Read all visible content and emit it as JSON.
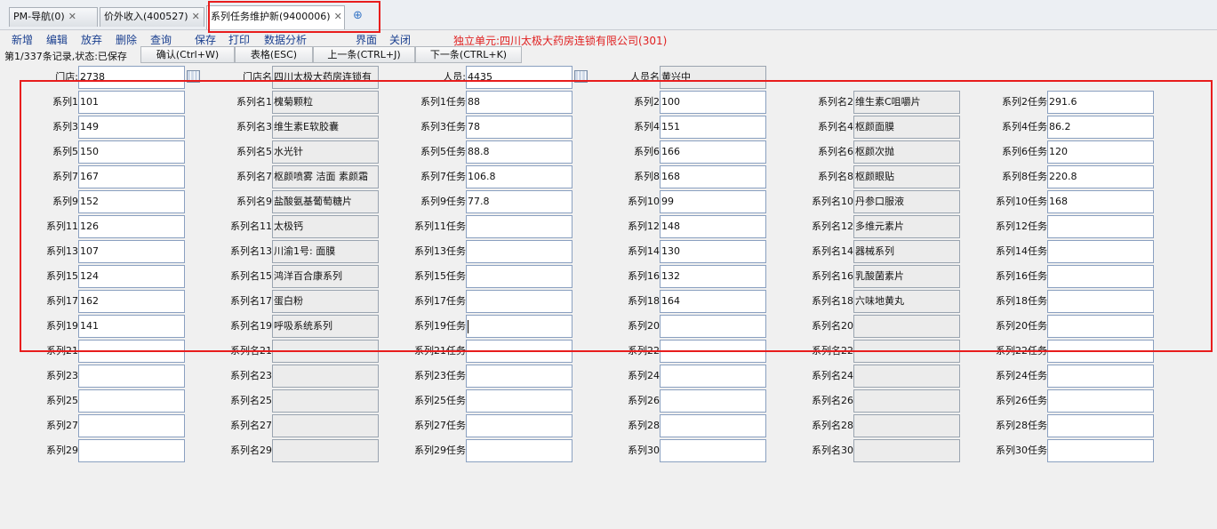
{
  "tabs": [
    {
      "label": "PM-导航(0)"
    },
    {
      "label": "价外收入(400527)"
    },
    {
      "label": "系列任务维护新(9400006)"
    }
  ],
  "toolbar": {
    "items": [
      "新增",
      "编辑",
      "放弃",
      "删除",
      "查询",
      "保存",
      "打印",
      "数据分析",
      "界面",
      "关闭"
    ]
  },
  "unit_text": "独立单元:四川太极大药房连锁有限公司(301)",
  "status": {
    "record": "第1/337条记录,状态:已保存"
  },
  "actions": [
    "确认(Ctrl+W)",
    "表格(ESC)",
    "上一条(CTRL+J)",
    "下一条(CTRL+K)"
  ],
  "header": {
    "store_label": "门店:",
    "store_value": "2738",
    "store_name_label": "门店名",
    "store_name_value": "四川太极大药房连锁有",
    "person_label": "人员:",
    "person_value": "4435",
    "person_name_label": "人员名",
    "person_name_value": "黄兴中"
  },
  "series": [
    {
      "l1": "系列1",
      "v1": "101",
      "l2": "系列名1",
      "v2": "槐菊颗粒",
      "l3": "系列1任务",
      "v3": "88"
    },
    {
      "l1": "系列2",
      "v1": "100",
      "l2": "系列名2",
      "v2": "维生素C咀嚼片",
      "l3": "系列2任务",
      "v3": "291.6"
    },
    {
      "l1": "系列3",
      "v1": "149",
      "l2": "系列名3",
      "v2": "维生素E软胶囊",
      "l3": "系列3任务",
      "v3": "78"
    },
    {
      "l1": "系列4",
      "v1": "151",
      "l2": "系列名4",
      "v2": "枢颜面膜",
      "l3": "系列4任务",
      "v3": "86.2"
    },
    {
      "l1": "系列5",
      "v1": "150",
      "l2": "系列名5",
      "v2": "水光针",
      "l3": "系列5任务",
      "v3": "88.8"
    },
    {
      "l1": "系列6",
      "v1": "166",
      "l2": "系列名6",
      "v2": "枢颜次抛",
      "l3": "系列6任务",
      "v3": "120"
    },
    {
      "l1": "系列7",
      "v1": "167",
      "l2": "系列名7",
      "v2": "枢颜喷雾 洁面 素颜霜",
      "l3": "系列7任务",
      "v3": "106.8"
    },
    {
      "l1": "系列8",
      "v1": "168",
      "l2": "系列名8",
      "v2": "枢颜眼贴",
      "l3": "系列8任务",
      "v3": "220.8"
    },
    {
      "l1": "系列9",
      "v1": "152",
      "l2": "系列名9",
      "v2": "盐酸氨基葡萄糖片",
      "l3": "系列9任务",
      "v3": "77.8"
    },
    {
      "l1": "系列10",
      "v1": "99",
      "l2": "系列名10",
      "v2": "丹参口服液",
      "l3": "系列10任务",
      "v3": "168"
    },
    {
      "l1": "系列11",
      "v1": "126",
      "l2": "系列名11",
      "v2": "太极钙",
      "l3": "系列11任务",
      "v3": ""
    },
    {
      "l1": "系列12",
      "v1": "148",
      "l2": "系列名12",
      "v2": "多维元素片",
      "l3": "系列12任务",
      "v3": ""
    },
    {
      "l1": "系列13",
      "v1": "107",
      "l2": "系列名13",
      "v2": "川渝1号: 面膜",
      "l3": "系列13任务",
      "v3": ""
    },
    {
      "l1": "系列14",
      "v1": "130",
      "l2": "系列名14",
      "v2": "器械系列",
      "l3": "系列14任务",
      "v3": ""
    },
    {
      "l1": "系列15",
      "v1": "124",
      "l2": "系列名15",
      "v2": "鸿洋百合康系列",
      "l3": "系列15任务",
      "v3": ""
    },
    {
      "l1": "系列16",
      "v1": "132",
      "l2": "系列名16",
      "v2": "乳酸菌素片",
      "l3": "系列16任务",
      "v3": ""
    },
    {
      "l1": "系列17",
      "v1": "162",
      "l2": "系列名17",
      "v2": "蛋白粉",
      "l3": "系列17任务",
      "v3": ""
    },
    {
      "l1": "系列18",
      "v1": "164",
      "l2": "系列名18",
      "v2": "六味地黄丸",
      "l3": "系列18任务",
      "v3": ""
    },
    {
      "l1": "系列19",
      "v1": "141",
      "l2": "系列名19",
      "v2": "呼吸系统系列",
      "l3": "系列19任务",
      "v3": ""
    },
    {
      "l1": "系列20",
      "v1": "",
      "l2": "系列名20",
      "v2": "",
      "l3": "系列20任务",
      "v3": ""
    },
    {
      "l1": "系列21",
      "v1": "",
      "l2": "系列名21",
      "v2": "",
      "l3": "系列21任务",
      "v3": ""
    },
    {
      "l1": "系列22",
      "v1": "",
      "l2": "系列名22",
      "v2": "",
      "l3": "系列22任务",
      "v3": ""
    },
    {
      "l1": "系列23",
      "v1": "",
      "l2": "系列名23",
      "v2": "",
      "l3": "系列23任务",
      "v3": ""
    },
    {
      "l1": "系列24",
      "v1": "",
      "l2": "系列名24",
      "v2": "",
      "l3": "系列24任务",
      "v3": ""
    },
    {
      "l1": "系列25",
      "v1": "",
      "l2": "系列名25",
      "v2": "",
      "l3": "系列25任务",
      "v3": ""
    },
    {
      "l1": "系列26",
      "v1": "",
      "l2": "系列名26",
      "v2": "",
      "l3": "系列26任务",
      "v3": ""
    },
    {
      "l1": "系列27",
      "v1": "",
      "l2": "系列名27",
      "v2": "",
      "l3": "系列27任务",
      "v3": ""
    },
    {
      "l1": "系列28",
      "v1": "",
      "l2": "系列名28",
      "v2": "",
      "l3": "系列28任务",
      "v3": ""
    },
    {
      "l1": "系列29",
      "v1": "",
      "l2": "系列名29",
      "v2": "",
      "l3": "系列29任务",
      "v3": ""
    },
    {
      "l1": "系列30",
      "v1": "",
      "l2": "系列名30",
      "v2": "",
      "l3": "系列30任务",
      "v3": ""
    }
  ]
}
